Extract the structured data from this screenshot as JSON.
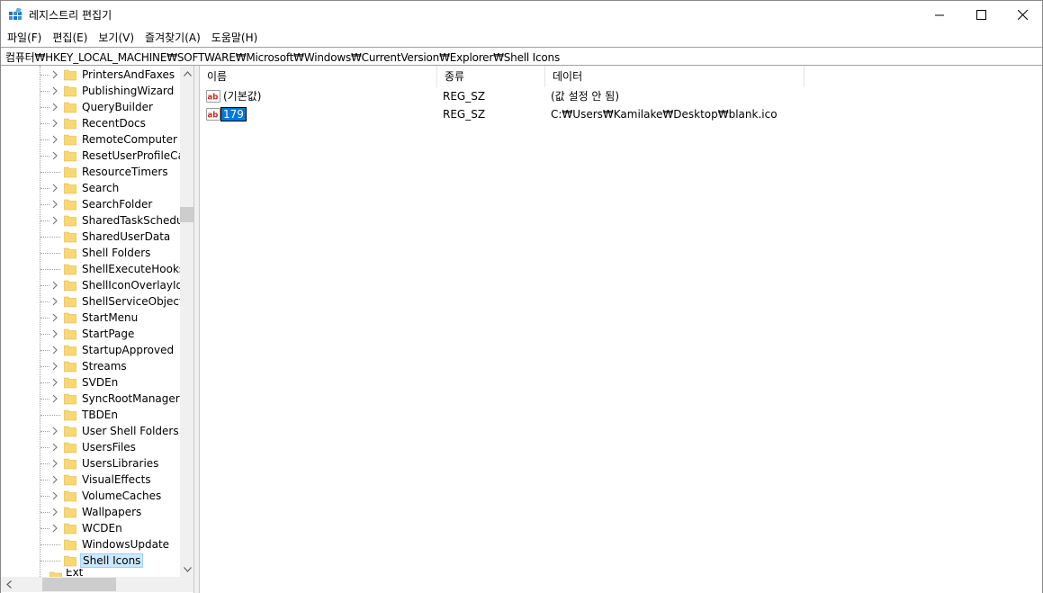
{
  "window": {
    "title": "레지스트리 편집기",
    "app_icon": "regedit-icon",
    "controls": {
      "minimize": "minimize-icon",
      "maximize": "maximize-icon",
      "close": "close-icon"
    }
  },
  "menu": [
    "파일(F)",
    "편집(E)",
    "보기(V)",
    "즐겨찾기(A)",
    "도움말(H)"
  ],
  "address": "컴퓨터₩HKEY_LOCAL_MACHINE₩SOFTWARE₩Microsoft₩Windows₩CurrentVersion₩Explorer₩Shell Icons",
  "tree": {
    "items": [
      {
        "label": "PrintersAndFaxes",
        "expandable": true
      },
      {
        "label": "PublishingWizard",
        "expandable": true
      },
      {
        "label": "QueryBuilder",
        "expandable": true
      },
      {
        "label": "RecentDocs",
        "expandable": true
      },
      {
        "label": "RemoteComputer",
        "expandable": true
      },
      {
        "label": "ResetUserProfileCallb",
        "expandable": true
      },
      {
        "label": "ResourceTimers",
        "expandable": false
      },
      {
        "label": "Search",
        "expandable": true
      },
      {
        "label": "SearchFolder",
        "expandable": true
      },
      {
        "label": "SharedTaskSchedule",
        "expandable": true
      },
      {
        "label": "SharedUserData",
        "expandable": false
      },
      {
        "label": "Shell Folders",
        "expandable": false
      },
      {
        "label": "ShellExecuteHooks",
        "expandable": false
      },
      {
        "label": "ShellIconOverlayIder",
        "expandable": true
      },
      {
        "label": "ShellServiceObjects",
        "expandable": true
      },
      {
        "label": "StartMenu",
        "expandable": true
      },
      {
        "label": "StartPage",
        "expandable": true
      },
      {
        "label": "StartupApproved",
        "expandable": true
      },
      {
        "label": "Streams",
        "expandable": true
      },
      {
        "label": "SVDEn",
        "expandable": true
      },
      {
        "label": "SyncRootManager",
        "expandable": true
      },
      {
        "label": "TBDEn",
        "expandable": false
      },
      {
        "label": "User Shell Folders",
        "expandable": true
      },
      {
        "label": "UsersFiles",
        "expandable": true
      },
      {
        "label": "UsersLibraries",
        "expandable": true
      },
      {
        "label": "VisualEffects",
        "expandable": true
      },
      {
        "label": "VolumeCaches",
        "expandable": true
      },
      {
        "label": "Wallpapers",
        "expandable": true
      },
      {
        "label": "WCDEn",
        "expandable": true
      },
      {
        "label": "WindowsUpdate",
        "expandable": false
      },
      {
        "label": "Shell Icons",
        "expandable": false,
        "selected": true
      }
    ],
    "partial_next": "Ext"
  },
  "list": {
    "columns": {
      "name": "이름",
      "type": "종류",
      "data": "데이터"
    },
    "rows": [
      {
        "icon": "string-value-icon",
        "name": "(기본값)",
        "type": "REG_SZ",
        "data": "(값 설정 안 됨)",
        "editing": false
      },
      {
        "icon": "string-value-icon",
        "name": "179",
        "type": "REG_SZ",
        "data": "C:₩Users₩Kamilake₩Desktop₩blank.ico",
        "editing": true
      }
    ]
  },
  "colors": {
    "selection_edit": "#0078d7",
    "tree_selected": "#cce8ff",
    "folder": "#f8d775",
    "string_icon_red": "#c42b1c"
  }
}
